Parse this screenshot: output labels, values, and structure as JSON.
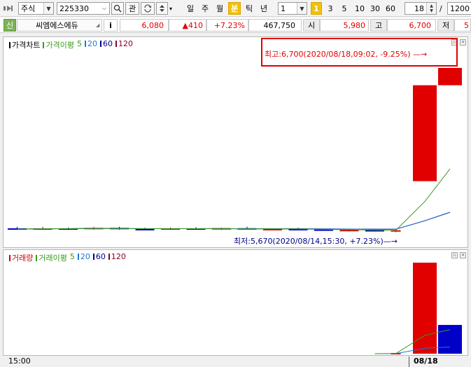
{
  "toolbar": {
    "market_type": "주식",
    "stock_code": "225330",
    "search_icon": "search-icon",
    "kwan_label": "관",
    "period_buttons": [
      "일",
      "주",
      "월",
      "분",
      "틱",
      "년"
    ],
    "active_period": "분",
    "interval_value": "1",
    "interval_presets": [
      "1",
      "3",
      "5",
      "10",
      "30",
      "60"
    ],
    "active_preset": "1",
    "count_value": "18",
    "slash": "/",
    "total_value": "1200"
  },
  "info": {
    "badge": "신",
    "stock_name": "씨엠에스에듀",
    "info_button": "i",
    "price": "6,080",
    "change": "▲410",
    "change_pct": "+7.23%",
    "volume": "467,750",
    "open_label": "시",
    "open_value": "5,980",
    "high_label": "고",
    "high_value": "6,700",
    "low_label": "저",
    "low_value": "5"
  },
  "price_panel": {
    "legend": [
      {
        "label": "가격차트",
        "color": "#000000"
      },
      {
        "label": "가격이평",
        "color": "#3a9a1a"
      },
      {
        "label": "5",
        "color": "#3a9a1a"
      },
      {
        "label": "20",
        "color": "#1a7ad8"
      },
      {
        "label": "60",
        "color": "#00008a"
      },
      {
        "label": "120",
        "color": "#8a0020"
      }
    ],
    "high_annotation": "최고:6,700(2020/08/18,09:02, -9.25%)",
    "low_annotation": "최저:5,670(2020/08/14,15:30, +7.23%)"
  },
  "volume_panel": {
    "legend": [
      {
        "label": "거래량",
        "color": "#d00000"
      },
      {
        "label": "거래이평",
        "color": "#3a9a1a"
      },
      {
        "label": "5",
        "color": "#3a9a1a"
      },
      {
        "label": "20",
        "color": "#1a7ad8"
      },
      {
        "label": "60",
        "color": "#00008a"
      },
      {
        "label": "120",
        "color": "#8a0020"
      }
    ]
  },
  "x_axis": {
    "left_label": "15:00",
    "right_label": "08/18"
  },
  "colors": {
    "up": "#e00000",
    "down": "#0000c8",
    "ma5": "#3a9a1a",
    "ma20": "#1a7ad8",
    "ma60": "#00008a",
    "ma120": "#8a0020",
    "highlight_box": "#e00000"
  },
  "chart_data": {
    "type": "candlestick",
    "candles": [
      {
        "o": 5680,
        "h": 5690,
        "l": 5670,
        "c": 5675
      },
      {
        "o": 5675,
        "h": 5690,
        "l": 5670,
        "c": 5680
      },
      {
        "o": 5680,
        "h": 5685,
        "l": 5670,
        "c": 5678
      },
      {
        "o": 5678,
        "h": 5690,
        "l": 5672,
        "c": 5683
      },
      {
        "o": 5683,
        "h": 5690,
        "l": 5672,
        "c": 5676
      },
      {
        "o": 5676,
        "h": 5684,
        "l": 5670,
        "c": 5674
      },
      {
        "o": 5674,
        "h": 5686,
        "l": 5670,
        "c": 5680
      },
      {
        "o": 5680,
        "h": 5688,
        "l": 5672,
        "c": 5676
      },
      {
        "o": 5676,
        "h": 5684,
        "l": 5670,
        "c": 5681
      },
      {
        "o": 5681,
        "h": 5690,
        "l": 5674,
        "c": 5672
      },
      {
        "o": 5672,
        "h": 5680,
        "l": 5670,
        "c": 5676
      },
      {
        "o": 5676,
        "h": 5684,
        "l": 5670,
        "c": 5673
      },
      {
        "o": 5673,
        "h": 5678,
        "l": 5670,
        "c": 5665
      },
      {
        "o": 5665,
        "h": 5675,
        "l": 5660,
        "c": 5670
      },
      {
        "o": 5670,
        "h": 5678,
        "l": 5660,
        "c": 5660
      },
      {
        "o": 5660,
        "h": 5672,
        "l": 5655,
        "c": 5668
      },
      {
        "o": 5980,
        "h": 6590,
        "l": 5990,
        "c": 6590
      },
      {
        "o": 6590,
        "h": 6700,
        "l": 6590,
        "c": 6700
      }
    ],
    "volumes": [
      0,
      0,
      0,
      0,
      0,
      0,
      0,
      0,
      0,
      0,
      0,
      0,
      0,
      0,
      0,
      1200,
      152000,
      48000
    ],
    "volume_colors": [
      "up",
      "down",
      "down",
      "up",
      "down",
      "up",
      "down",
      "up",
      "down",
      "up",
      "up",
      "down",
      "up",
      "up",
      "up",
      "up",
      "up",
      "down"
    ]
  }
}
